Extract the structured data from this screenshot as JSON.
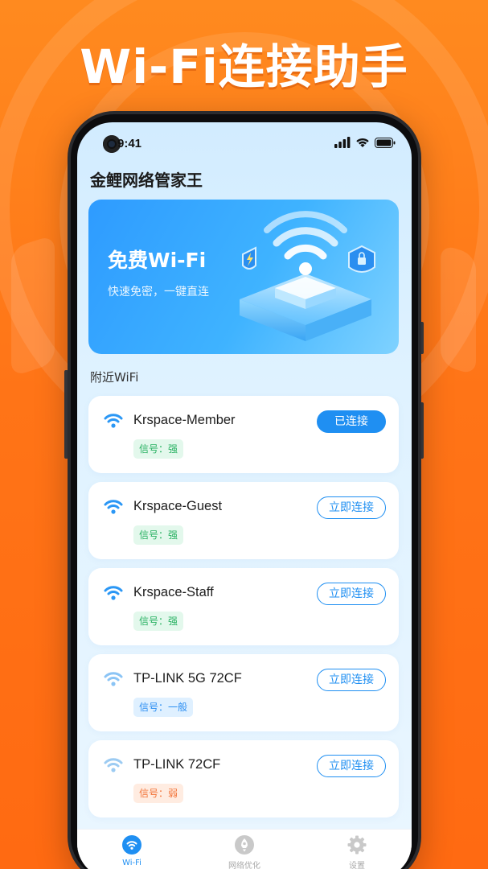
{
  "headline": "Wi-Fi连接助手",
  "status_bar": {
    "time": "9:41"
  },
  "app_title": "金鲤网络管家王",
  "banner": {
    "title": "免费Wi-Fi",
    "subtitle": "快速免密，一键直连"
  },
  "section_label": "附近WiFi",
  "networks": [
    {
      "ssid": "Krspace-Member",
      "signal": "信号：强",
      "level": "strong",
      "action": "已连接",
      "connected": true,
      "icon_color": "#2b97f5"
    },
    {
      "ssid": "Krspace-Guest",
      "signal": "信号：强",
      "level": "strong",
      "action": "立即连接",
      "connected": false,
      "icon_color": "#2b97f5"
    },
    {
      "ssid": "Krspace-Staff",
      "signal": "信号：强",
      "level": "strong",
      "action": "立即连接",
      "connected": false,
      "icon_color": "#2b97f5"
    },
    {
      "ssid": "TP-LINK 5G 72CF",
      "signal": "信号：一般",
      "level": "medium",
      "action": "立即连接",
      "connected": false,
      "icon_color": "#8bc4f5"
    },
    {
      "ssid": "TP-LINK 72CF",
      "signal": "信号：弱",
      "level": "weak",
      "action": "立即连接",
      "connected": false,
      "icon_color": "#9ccbf2"
    }
  ],
  "tabs": [
    {
      "label": "Wi-Fi",
      "icon": "wifi-icon",
      "active": true
    },
    {
      "label": "网络优化",
      "icon": "rocket-icon",
      "active": false
    },
    {
      "label": "设置",
      "icon": "gear-icon",
      "active": false
    }
  ],
  "colors": {
    "accent": "#1f8ff2",
    "background": "#ff7417"
  }
}
